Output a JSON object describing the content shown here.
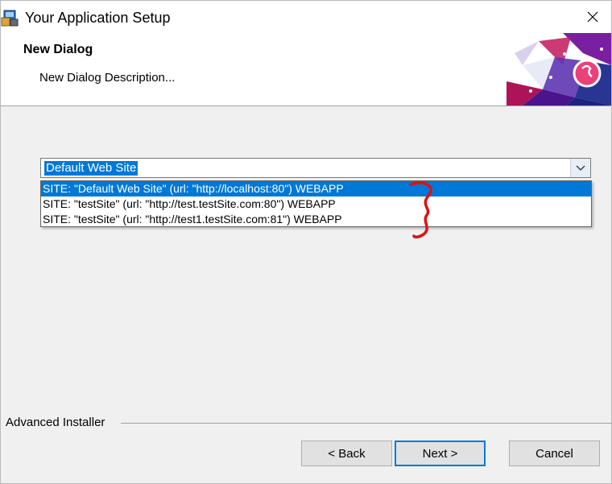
{
  "window": {
    "title": "Your Application Setup"
  },
  "header": {
    "title": "New Dialog",
    "description": "New Dialog Description..."
  },
  "combo": {
    "value": "Default Web Site",
    "items": [
      "SITE: \"Default Web Site\" (url: \"http://localhost:80\") WEBAPP",
      "SITE: \"testSite\" (url: \"http://test.testSite.com:80\") WEBAPP",
      "SITE: \"testSite\" (url: \"http://test1.testSite.com:81\") WEBAPP"
    ],
    "selected_index": 0
  },
  "footer": {
    "brand": "Advanced Installer",
    "back_label": "< Back",
    "next_label": "Next >",
    "cancel_label": "Cancel"
  },
  "colors": {
    "selection": "#0078d7",
    "annotation": "#e01010"
  },
  "icons": [
    "setup-app-icon",
    "close-icon",
    "chevron-down-icon",
    "banner-graphic"
  ]
}
